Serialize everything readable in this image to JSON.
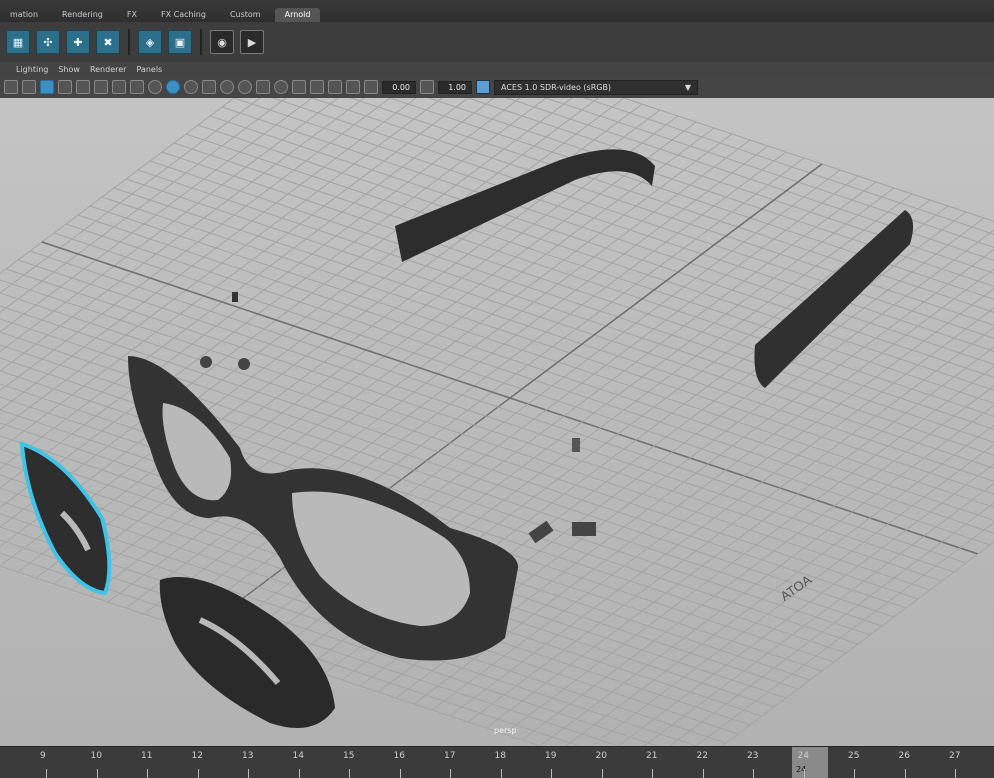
{
  "shelf": {
    "tabs": [
      "mation",
      "Rendering",
      "FX",
      "FX Caching",
      "Custom",
      "Arnold"
    ],
    "active_tab": "Arnold",
    "buttons": [
      "render-settings-icon",
      "ipr-icon",
      "sphere-light-icon",
      "area-light-icon",
      "skydome-icon",
      "volume-icon",
      "camera-eye-icon",
      "play-icon"
    ]
  },
  "panel_menu": [
    "Lighting",
    "Show",
    "Renderer",
    "Panels"
  ],
  "exposure": "0.00",
  "gamma": "1.00",
  "color_space": "ACES 1.0 SDR-video (sRGB)",
  "camera_label": "persp",
  "scene_text": "ATOA",
  "timeline": {
    "frames": [
      "9",
      "10",
      "11",
      "12",
      "13",
      "14",
      "15",
      "16",
      "17",
      "18",
      "19",
      "20",
      "21",
      "22",
      "23",
      "24",
      "25",
      "26",
      "27"
    ],
    "current_frame": "24"
  },
  "colors": {
    "selection": "#3fc4e8",
    "model": "#2e2e2e",
    "accent": "#5a9ed6"
  }
}
